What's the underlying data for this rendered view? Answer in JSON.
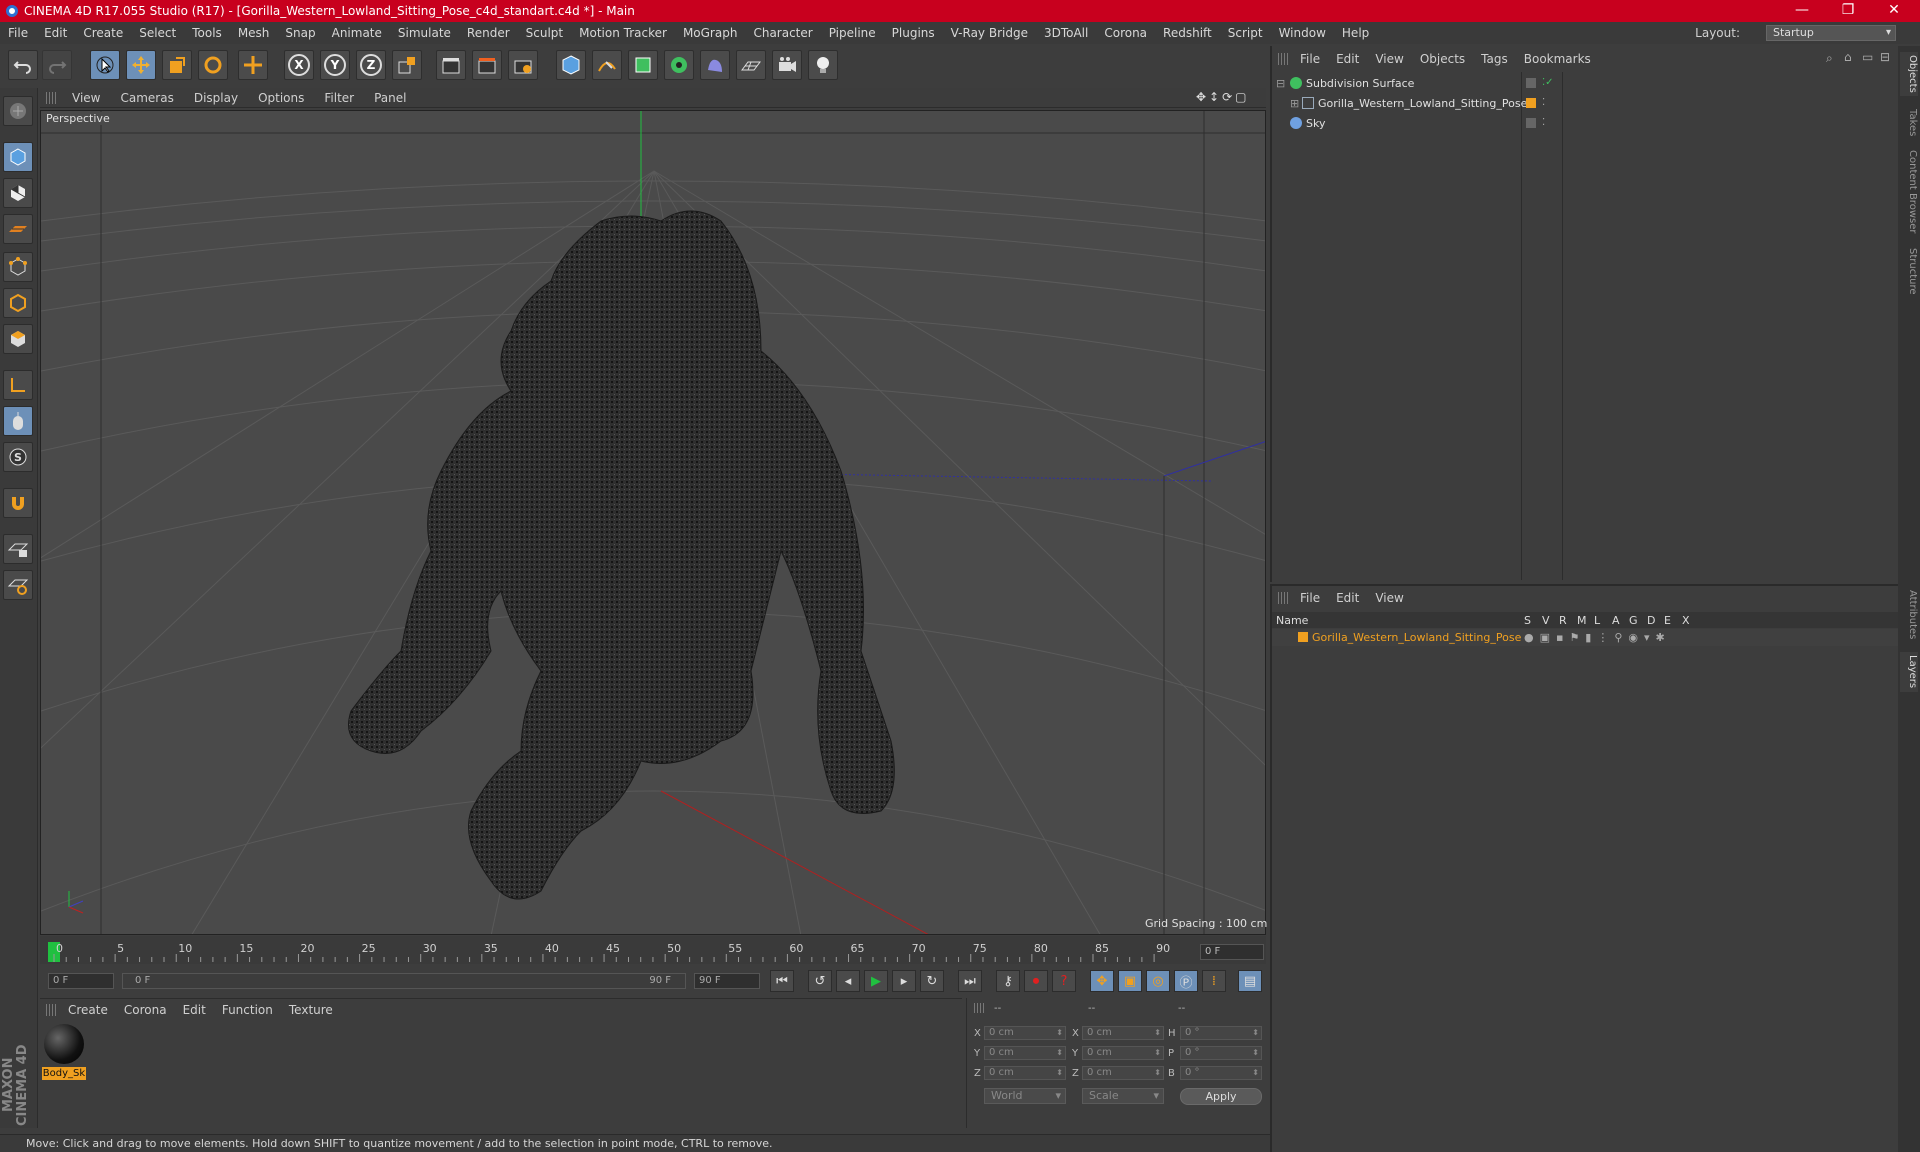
{
  "window": {
    "title": "CINEMA 4D R17.055 Studio (R17) - [Gorilla_Western_Lowland_Sitting_Pose_c4d_standart.c4d *] - Main",
    "minimize": "—",
    "maximize": "❐",
    "close": "✕"
  },
  "menubar": [
    "File",
    "Edit",
    "Create",
    "Select",
    "Tools",
    "Mesh",
    "Snap",
    "Animate",
    "Simulate",
    "Render",
    "Sculpt",
    "Motion Tracker",
    "MoGraph",
    "Character",
    "Pipeline",
    "Plugins",
    "V-Ray Bridge",
    "3DToAll",
    "Corona",
    "Redshift",
    "Script",
    "Window",
    "Help"
  ],
  "layout": {
    "label": "Layout:",
    "value": "Startup"
  },
  "toolbar": {
    "axis_x": "X",
    "axis_y": "Y",
    "axis_z": "Z"
  },
  "viewport": {
    "menu": [
      "View",
      "Cameras",
      "Display",
      "Options",
      "Filter",
      "Panel"
    ],
    "label": "Perspective",
    "grid_spacing": "Grid Spacing : 100 cm",
    "nav_icons": "✥↕⟳▢"
  },
  "timeline": {
    "ticks": [
      "0",
      "5",
      "10",
      "15",
      "20",
      "25",
      "30",
      "35",
      "40",
      "45",
      "50",
      "55",
      "60",
      "65",
      "70",
      "75",
      "80",
      "85",
      "90"
    ],
    "current_frame": "0 F",
    "range_current_frame": "0 F",
    "range_start_frame": "0 F",
    "range_end_frame": "90 F",
    "end_frame": "90 F",
    "max_frame": "90 F"
  },
  "material_panel": {
    "menu": [
      "Create",
      "Corona",
      "Edit",
      "Function",
      "Texture"
    ],
    "material_name": "Body_Sk"
  },
  "coordinates": {
    "headers": [
      "--",
      "--",
      "--"
    ],
    "rows": [
      {
        "a": "X",
        "av": "0 cm",
        "b": "X",
        "bv": "0 cm",
        "c": "H",
        "cv": "0 °"
      },
      {
        "a": "Y",
        "av": "0 cm",
        "b": "Y",
        "bv": "0 cm",
        "c": "P",
        "cv": "0 °"
      },
      {
        "a": "Z",
        "av": "0 cm",
        "b": "Z",
        "bv": "0 cm",
        "c": "B",
        "cv": "0 °"
      }
    ],
    "mode": "World",
    "transform": "Scale",
    "apply": "Apply"
  },
  "status": "Move: Click and drag to move elements. Hold down SHIFT to quantize movement / add to the selection in point mode, CTRL to remove.",
  "objects_panel": {
    "menu": [
      "File",
      "Edit",
      "View",
      "Objects",
      "Tags",
      "Bookmarks"
    ],
    "items": [
      {
        "name": "Subdivision Surface",
        "color": "#3fbf5f"
      },
      {
        "name": "Gorilla_Western_Lowland_Sitting_Pose",
        "color": "#7aa0d0"
      },
      {
        "name": "Sky",
        "color": "#6fa0e0"
      }
    ]
  },
  "layers_panel": {
    "menu": [
      "File",
      "Edit",
      "View"
    ],
    "columns": [
      "Name",
      "S",
      "V",
      "R",
      "M",
      "L",
      "A",
      "G",
      "D",
      "E",
      "X"
    ],
    "layer": "Gorilla_Western_Lowland_Sitting_Pose",
    "layer_color": "#f0a020"
  },
  "side_tabs": [
    "Objects",
    "Takes",
    "Content Browser",
    "Structure",
    "Attributes",
    "Layers"
  ],
  "maxon_logo": "MAXON CINEMA 4D"
}
